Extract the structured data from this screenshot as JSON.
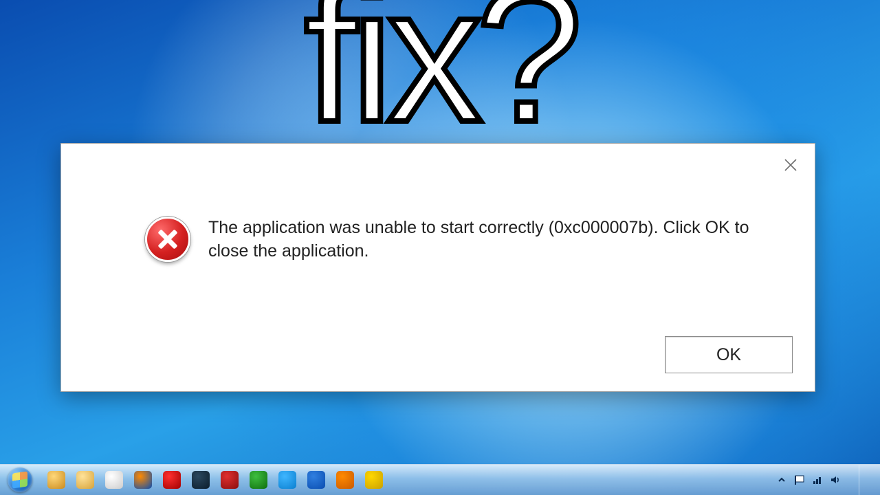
{
  "overlay": {
    "text": "fix?"
  },
  "dialog": {
    "message": "The application was unable to start correctly (0xc000007b). Click OK to close the application.",
    "ok_label": "OK"
  },
  "taskbar": {
    "items": [
      {
        "name": "explorer",
        "color1": "#ffd87a",
        "color2": "#c98a1e"
      },
      {
        "name": "folder",
        "color1": "#ffe39a",
        "color2": "#d6a23a"
      },
      {
        "name": "chrome",
        "color1": "#ffffff",
        "color2": "#cccccc"
      },
      {
        "name": "firefox",
        "color1": "#ff8a00",
        "color2": "#0a4db0"
      },
      {
        "name": "opera",
        "color1": "#ff3030",
        "color2": "#a00000"
      },
      {
        "name": "steam",
        "color1": "#2a475e",
        "color2": "#0b1d2b"
      },
      {
        "name": "app-red",
        "color1": "#e03030",
        "color2": "#8a0e0e"
      },
      {
        "name": "app-green",
        "color1": "#3fbf3f",
        "color2": "#0e6e0e"
      },
      {
        "name": "skype",
        "color1": "#3fb6ff",
        "color2": "#0a7fd0"
      },
      {
        "name": "teamviewer",
        "color1": "#2f7fe0",
        "color2": "#0a4db0"
      },
      {
        "name": "app-orange",
        "color1": "#ff8a00",
        "color2": "#c95a00"
      },
      {
        "name": "app-yellow",
        "color1": "#ffd700",
        "color2": "#c9a000"
      }
    ]
  },
  "tray": {
    "time": "",
    "date": ""
  }
}
